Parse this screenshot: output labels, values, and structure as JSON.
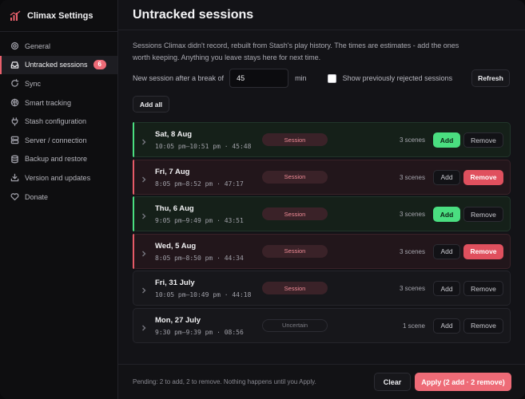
{
  "app": {
    "title": "Climax Settings"
  },
  "sidebar": {
    "items": [
      {
        "label": "General",
        "icon": "gear-icon"
      },
      {
        "label": "Untracked sessions",
        "icon": "inbox-icon",
        "badge": "6",
        "active": true
      },
      {
        "label": "Sync",
        "icon": "sync-icon"
      },
      {
        "label": "Smart tracking",
        "icon": "brain-icon"
      },
      {
        "label": "Stash configuration",
        "icon": "plug-icon"
      },
      {
        "label": "Server / connection",
        "icon": "server-icon"
      },
      {
        "label": "Backup and restore",
        "icon": "database-icon"
      },
      {
        "label": "Version and updates",
        "icon": "download-icon"
      },
      {
        "label": "Donate",
        "icon": "heart-icon"
      }
    ]
  },
  "page": {
    "title": "Untracked sessions",
    "description": "Sessions Climax didn't record, rebuilt from Stash's play history. The times are estimates - add the ones worth keeping. Anything you leave stays here for next time.",
    "break_label": "New session after a break of",
    "break_value": "45",
    "break_unit": "min",
    "show_rejected_label": "Show previously rejected sessions",
    "refresh_label": "Refresh",
    "add_all_label": "Add all"
  },
  "sessions": [
    {
      "date": "Sat, 8 Aug",
      "meta": "10:05 pm–10:51 pm · 45:48",
      "tag": "Session",
      "scenes": "3 scenes",
      "state": "add",
      "add_label": "Add",
      "remove_label": "Remove"
    },
    {
      "date": "Fri, 7 Aug",
      "meta": "8:05 pm–8:52 pm · 47:17",
      "tag": "Session",
      "scenes": "3 scenes",
      "state": "remove",
      "add_label": "Add",
      "remove_label": "Remove"
    },
    {
      "date": "Thu, 6 Aug",
      "meta": "9:05 pm–9:49 pm · 43:51",
      "tag": "Session",
      "scenes": "3 scenes",
      "state": "add",
      "add_label": "Add",
      "remove_label": "Remove"
    },
    {
      "date": "Wed, 5 Aug",
      "meta": "8:05 pm–8:50 pm · 44:34",
      "tag": "Session",
      "scenes": "3 scenes",
      "state": "remove",
      "add_label": "Add",
      "remove_label": "Remove"
    },
    {
      "date": "Fri, 31 July",
      "meta": "10:05 pm–10:49 pm · 44:18",
      "tag": "Session",
      "scenes": "3 scenes",
      "state": "none",
      "add_label": "Add",
      "remove_label": "Remove"
    },
    {
      "date": "Mon, 27 July",
      "meta": "9:30 pm–9:39 pm · 08:56",
      "tag": "Uncertain",
      "scenes": "1 scene",
      "state": "none",
      "add_label": "Add",
      "remove_label": "Remove"
    }
  ],
  "footer": {
    "pending": "Pending: 2 to add, 2 to remove. Nothing happens until you Apply.",
    "clear_label": "Clear",
    "apply_label": "Apply (2 add · 2 remove)"
  },
  "colors": {
    "accent": "#ee6b77",
    "add": "#4ade80",
    "remove": "#e0505e"
  }
}
